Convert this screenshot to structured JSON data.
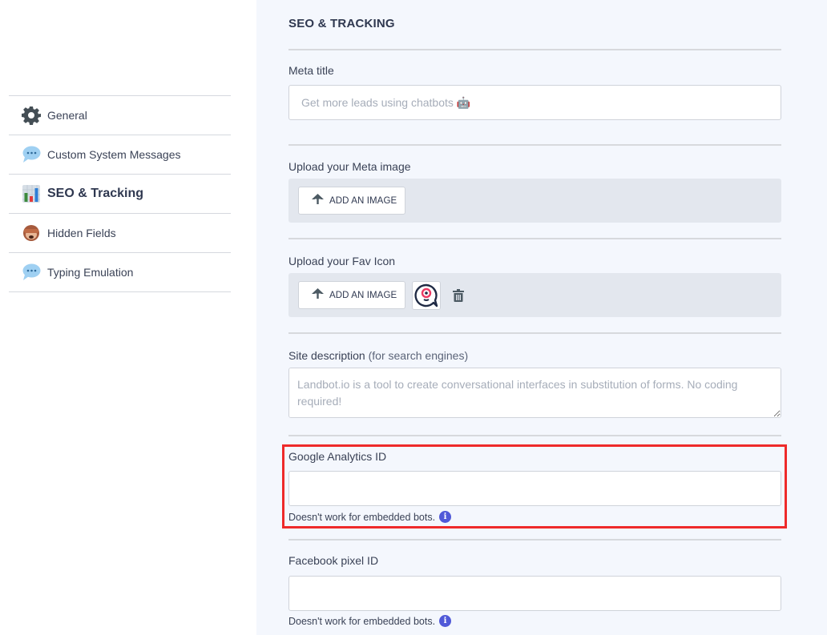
{
  "sidebar": {
    "items": [
      {
        "label": "General",
        "icon": "gear-icon",
        "active": false
      },
      {
        "label": "Custom System Messages",
        "icon": "speech-bubble-icon",
        "active": false
      },
      {
        "label": "SEO & Tracking",
        "icon": "bar-chart-icon",
        "active": true
      },
      {
        "label": "Hidden Fields",
        "icon": "see-no-evil-monkey-icon",
        "active": false
      },
      {
        "label": "Typing Emulation",
        "icon": "speech-bubble-icon",
        "active": false
      }
    ]
  },
  "main": {
    "title": "SEO & TRACKING",
    "meta_title": {
      "label": "Meta title",
      "value": "",
      "placeholder": "Get more leads using chatbots 🤖"
    },
    "meta_image": {
      "label": "Upload your Meta image",
      "button_label": "ADD AN IMAGE"
    },
    "fav_icon": {
      "label": "Upload your Fav Icon",
      "button_label": "ADD AN IMAGE",
      "has_preview": true
    },
    "site_description": {
      "label": "Site description",
      "label_suffix": "(for search engines)",
      "value": "",
      "placeholder": "Landbot.io is a tool to create conversational interfaces in substitution of forms. No coding required!"
    },
    "google_analytics": {
      "label": "Google Analytics ID",
      "value": "",
      "hint": "Doesn't work for embedded bots."
    },
    "facebook_pixel": {
      "label": "Facebook pixel ID",
      "value": "",
      "hint": "Doesn't work for embedded bots."
    }
  },
  "colors": {
    "main_background": "#f4f7fd",
    "upload_area": "#e3e7ee",
    "info_badge": "#5059d8",
    "highlight_border": "#ee2a2a",
    "text": "#3a4256"
  }
}
